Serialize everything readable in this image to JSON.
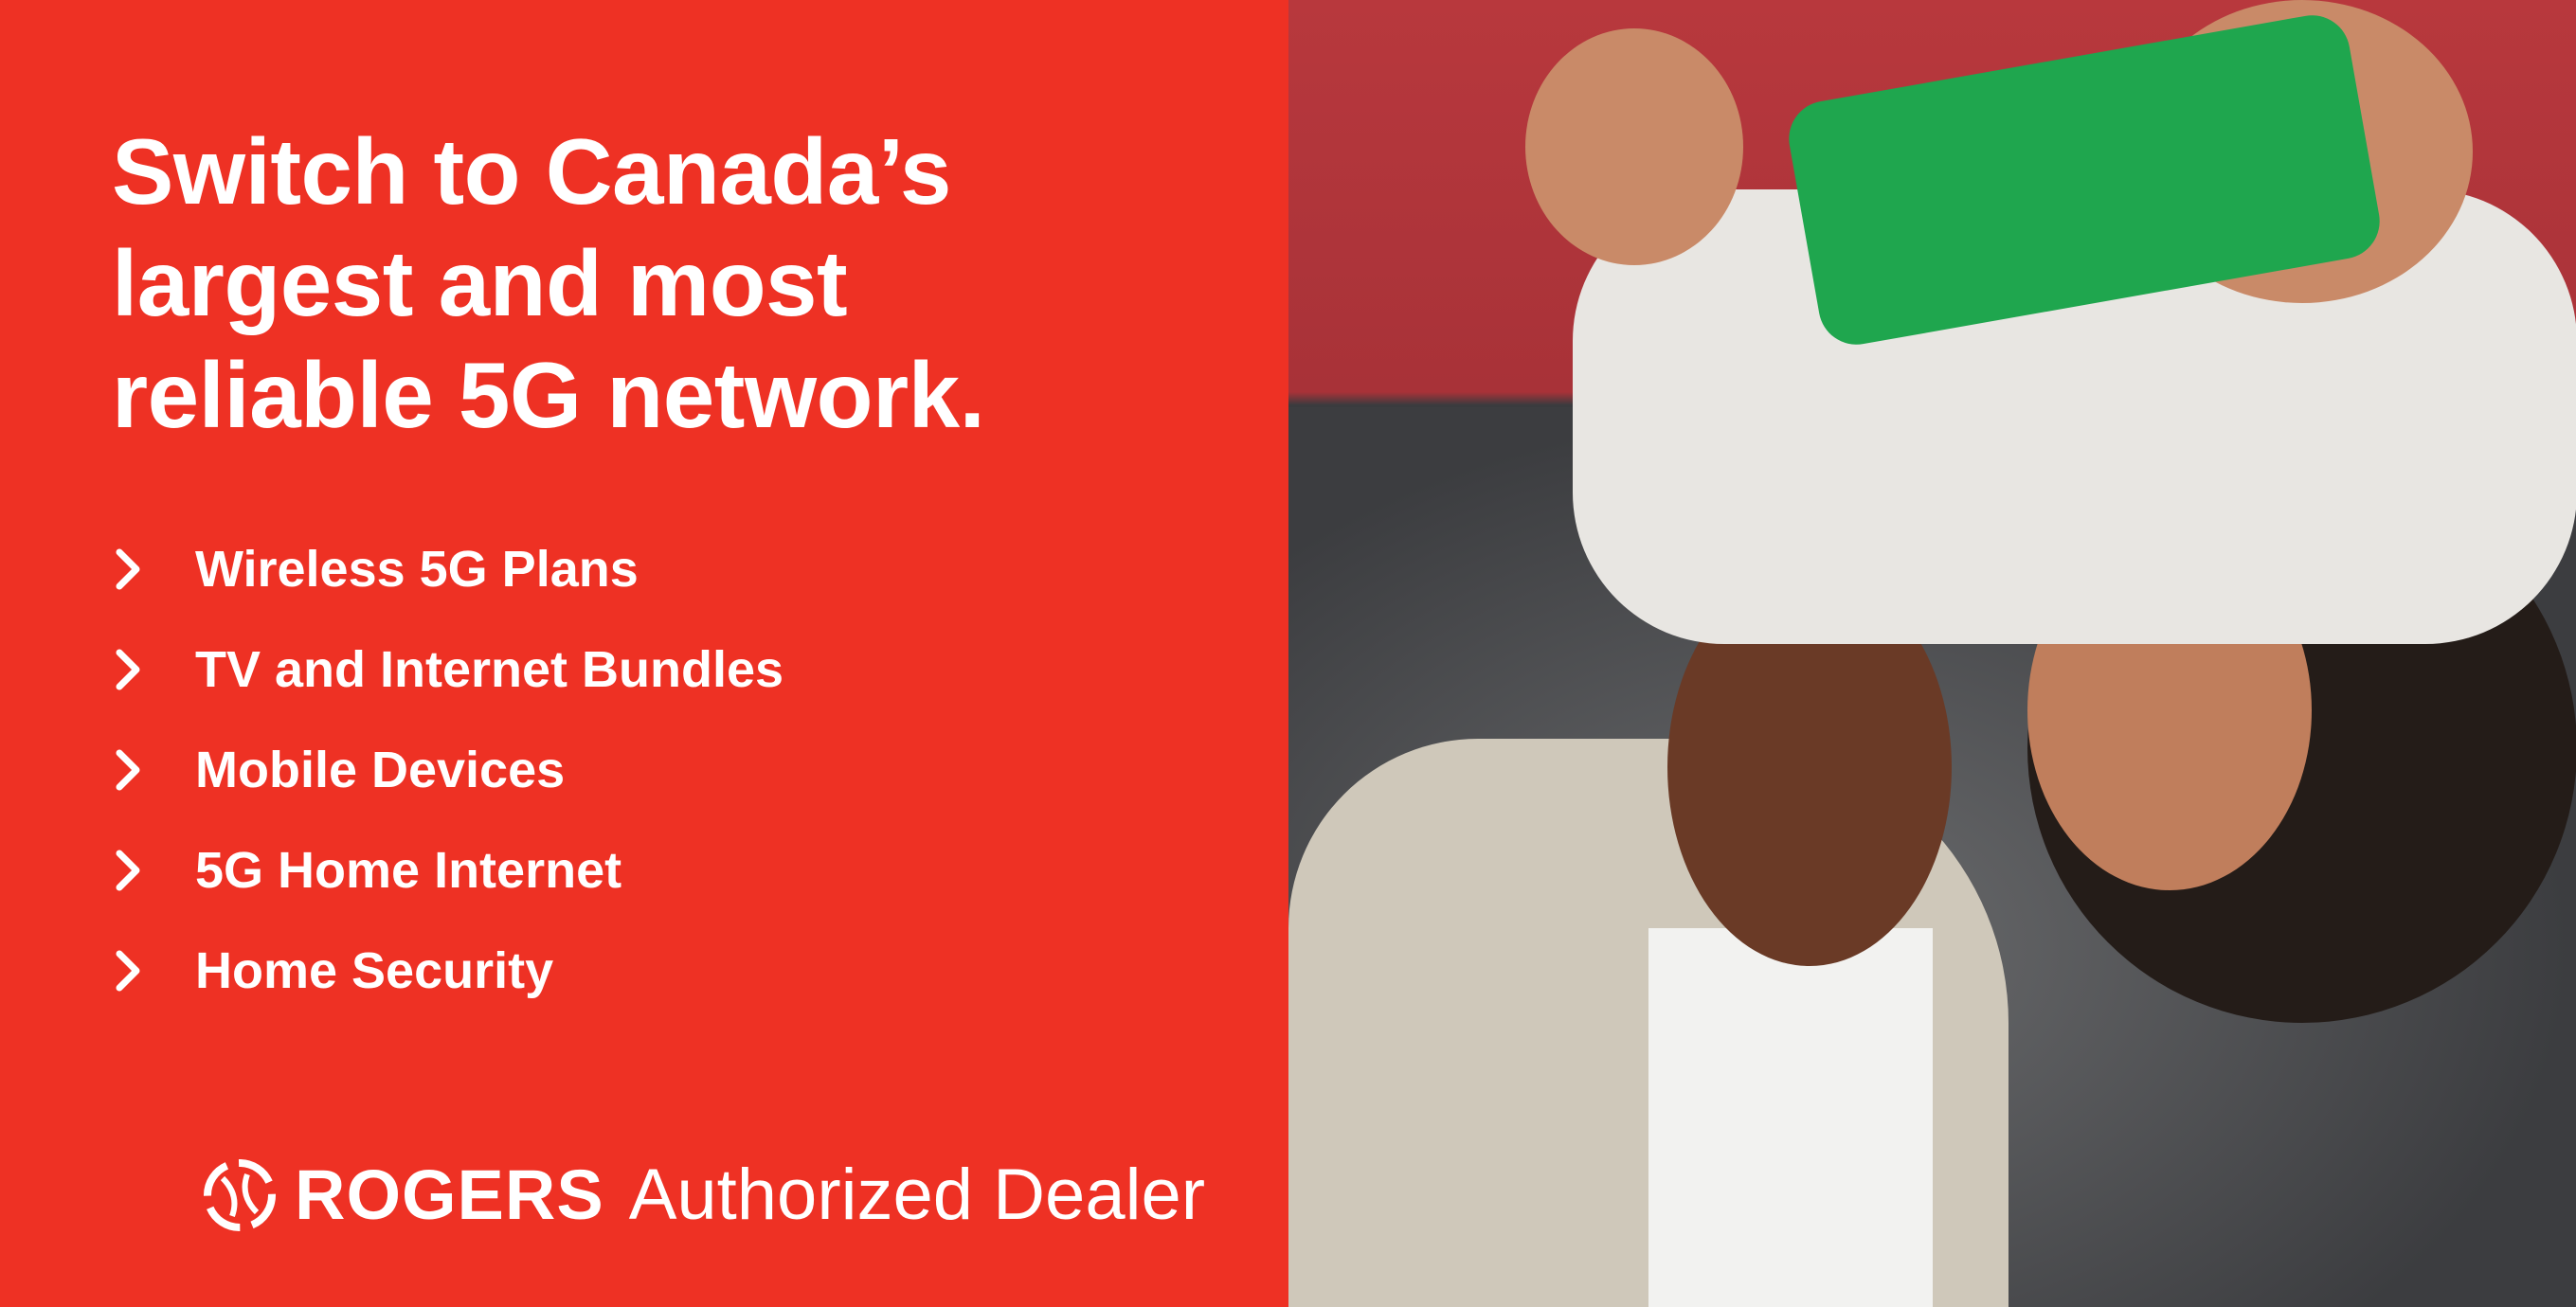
{
  "headline": {
    "lines": [
      "Switch to Canada’s",
      "largest and most",
      "reliable 5G network."
    ]
  },
  "services": [
    {
      "label": "Wireless 5G Plans",
      "icon": "chevron-right-icon"
    },
    {
      "label": "TV and Internet Bundles",
      "icon": "chevron-right-icon"
    },
    {
      "label": "Mobile Devices",
      "icon": "chevron-right-icon"
    },
    {
      "label": "5G Home Internet",
      "icon": "chevron-right-icon"
    },
    {
      "label": "Home Security",
      "icon": "chevron-right-icon"
    }
  ],
  "footer": {
    "brand": "ROGERS",
    "tagline": "Authorized Dealer",
    "logo_icon": "rogers-swirl-logo"
  },
  "colors": {
    "brand_red": "#EE3124",
    "text": "#FFFFFF"
  }
}
